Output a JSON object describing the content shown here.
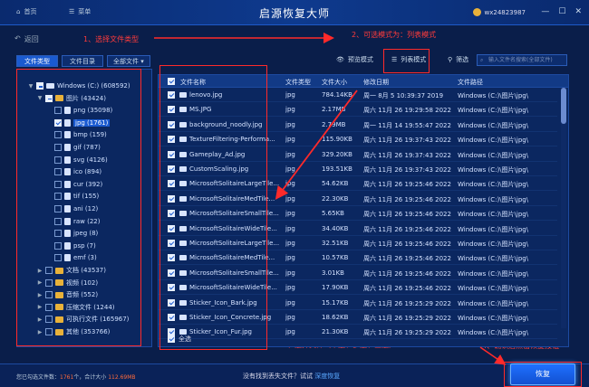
{
  "app": {
    "title": "启源恢复大师",
    "nav_home": "首页",
    "nav_menu": "菜单",
    "user": "wx24823987",
    "back": "返回"
  },
  "annotations": {
    "step1": "1、选择文件类型",
    "step2": "2、可选模式为：列表模式",
    "step3": "3、选择文件（单选、多选、全选）",
    "step4": "4、确认后点击恢复按钮"
  },
  "toolbar": {
    "tab_type": "文件类型",
    "tab_dir": "文件目录",
    "filter_select": "全部文件",
    "preview_mode": "预览模式",
    "list_mode": "列表模式",
    "filter": "筛选",
    "search_placeholder": "输入文件名搜索(全部文件)"
  },
  "tree": [
    {
      "label": "Windows (C:) (608592)",
      "level": 0,
      "toggle": "▼",
      "state": "partial",
      "icon": "drive"
    },
    {
      "label": "图片 (43424)",
      "level": 1,
      "toggle": "▼",
      "state": "partial",
      "icon": "folder"
    },
    {
      "label": "png (35098)",
      "level": 2,
      "toggle": "",
      "state": "none",
      "icon": "folder"
    },
    {
      "label": "jpg (1761)",
      "level": 2,
      "toggle": "",
      "state": "checked",
      "icon": "folder"
    },
    {
      "label": "bmp (159)",
      "level": 2,
      "toggle": "",
      "state": "none",
      "icon": "folder"
    },
    {
      "label": "gif (787)",
      "level": 2,
      "toggle": "",
      "state": "none",
      "icon": "folder"
    },
    {
      "label": "svg (4126)",
      "level": 2,
      "toggle": "",
      "state": "none",
      "icon": "folder"
    },
    {
      "label": "ico (894)",
      "level": 2,
      "toggle": "",
      "state": "none",
      "icon": "folder"
    },
    {
      "label": "cur (392)",
      "level": 2,
      "toggle": "",
      "state": "none",
      "icon": "folder"
    },
    {
      "label": "tif (155)",
      "level": 2,
      "toggle": "",
      "state": "none",
      "icon": "folder"
    },
    {
      "label": "ani (12)",
      "level": 2,
      "toggle": "",
      "state": "none",
      "icon": "folder"
    },
    {
      "label": "raw (22)",
      "level": 2,
      "toggle": "",
      "state": "none",
      "icon": "folder"
    },
    {
      "label": "jpeg (8)",
      "level": 2,
      "toggle": "",
      "state": "none",
      "icon": "folder"
    },
    {
      "label": "psp (7)",
      "level": 2,
      "toggle": "",
      "state": "none",
      "icon": "folder"
    },
    {
      "label": "emf (3)",
      "level": 2,
      "toggle": "",
      "state": "none",
      "icon": "folder"
    },
    {
      "label": "文档 (43537)",
      "level": 1,
      "toggle": "▶",
      "state": "none",
      "icon": "folder"
    },
    {
      "label": "视频 (102)",
      "level": 1,
      "toggle": "▶",
      "state": "none",
      "icon": "folder"
    },
    {
      "label": "音频 (552)",
      "level": 1,
      "toggle": "▶",
      "state": "none",
      "icon": "folder"
    },
    {
      "label": "压缩文件 (1244)",
      "level": 1,
      "toggle": "▶",
      "state": "none",
      "icon": "folder"
    },
    {
      "label": "可执行文件 (165967)",
      "level": 1,
      "toggle": "▶",
      "state": "none",
      "icon": "folder"
    },
    {
      "label": "其他 (353766)",
      "level": 1,
      "toggle": "▶",
      "state": "none",
      "icon": "folder"
    }
  ],
  "table": {
    "headers": [
      "文件名称",
      "文件类型",
      "文件大小",
      "修改日期",
      "文件路径"
    ],
    "rows": [
      [
        "lenovo.jpg",
        "jpg",
        "784.14KB",
        "周一 8月 5 10:39:37 2019",
        "Windows (C:)\\图片\\jpg\\"
      ],
      [
        "MS.JPG",
        "jpg",
        "2.17MB",
        "周六 11月 26 19:29:58 2022",
        "Windows (C:)\\图片\\jpg\\"
      ],
      [
        "background_noodly.jpg",
        "jpg",
        "2.79MB",
        "周一 11月 14 19:55:47 2022",
        "Windows (C:)\\图片\\jpg\\"
      ],
      [
        "TextureFiltering-Performa...",
        "jpg",
        "115.90KB",
        "周六 11月 26 19:37:43 2022",
        "Windows (C:)\\图片\\jpg\\"
      ],
      [
        "Gameplay_Ad.jpg",
        "jpg",
        "329.20KB",
        "周六 11月 26 19:37:43 2022",
        "Windows (C:)\\图片\\jpg\\"
      ],
      [
        "CustomScaling.jpg",
        "jpg",
        "193.51KB",
        "周六 11月 26 19:37:43 2022",
        "Windows (C:)\\图片\\jpg\\"
      ],
      [
        "MicrosoftSolitaireLargeTile...",
        "jpg",
        "54.62KB",
        "周六 11月 26 19:25:46 2022",
        "Windows (C:)\\图片\\jpg\\"
      ],
      [
        "MicrosoftSolitaireMedTile...",
        "jpg",
        "22.30KB",
        "周六 11月 26 19:25:46 2022",
        "Windows (C:)\\图片\\jpg\\"
      ],
      [
        "MicrosoftSolitaireSmallTile...",
        "jpg",
        "5.65KB",
        "周六 11月 26 19:25:46 2022",
        "Windows (C:)\\图片\\jpg\\"
      ],
      [
        "MicrosoftSolitaireWideTile...",
        "jpg",
        "34.40KB",
        "周六 11月 26 19:25:46 2022",
        "Windows (C:)\\图片\\jpg\\"
      ],
      [
        "MicrosoftSolitaireLargeTile...",
        "jpg",
        "32.51KB",
        "周六 11月 26 19:25:46 2022",
        "Windows (C:)\\图片\\jpg\\"
      ],
      [
        "MicrosoftSolitaireMedTile...",
        "jpg",
        "10.57KB",
        "周六 11月 26 19:25:46 2022",
        "Windows (C:)\\图片\\jpg\\"
      ],
      [
        "MicrosoftSolitaireSmallTile...",
        "jpg",
        "3.01KB",
        "周六 11月 26 19:25:46 2022",
        "Windows (C:)\\图片\\jpg\\"
      ],
      [
        "MicrosoftSolitaireWideTile...",
        "jpg",
        "17.90KB",
        "周六 11月 26 19:25:46 2022",
        "Windows (C:)\\图片\\jpg\\"
      ],
      [
        "Sticker_Icon_Bark.jpg",
        "jpg",
        "15.17KB",
        "周六 11月 26 19:25:29 2022",
        "Windows (C:)\\图片\\jpg\\"
      ],
      [
        "Sticker_Icon_Concrete.jpg",
        "jpg",
        "18.62KB",
        "周六 11月 26 19:25:29 2022",
        "Windows (C:)\\图片\\jpg\\"
      ],
      [
        "Sticker_Icon_Fur.jpg",
        "jpg",
        "21.30KB",
        "周六 11月 26 19:25:29 2022",
        "Windows (C:)\\图片\\jpg\\"
      ]
    ],
    "select_all": "全选"
  },
  "status": {
    "selected_prefix": "您已勾选文件数：",
    "selected_count": "1761",
    "selected_mid": "个，合计大小",
    "selected_size": "112.69MB",
    "not_found": "没有找到丢失文件？试试",
    "deep_recover": "深度恢复",
    "recover_button": "恢复"
  },
  "colors": {
    "background": "#0a1e4a",
    "accent": "#1a5ad0",
    "annotation": "#ff2a2a",
    "highlight": "#ff6a3a"
  }
}
